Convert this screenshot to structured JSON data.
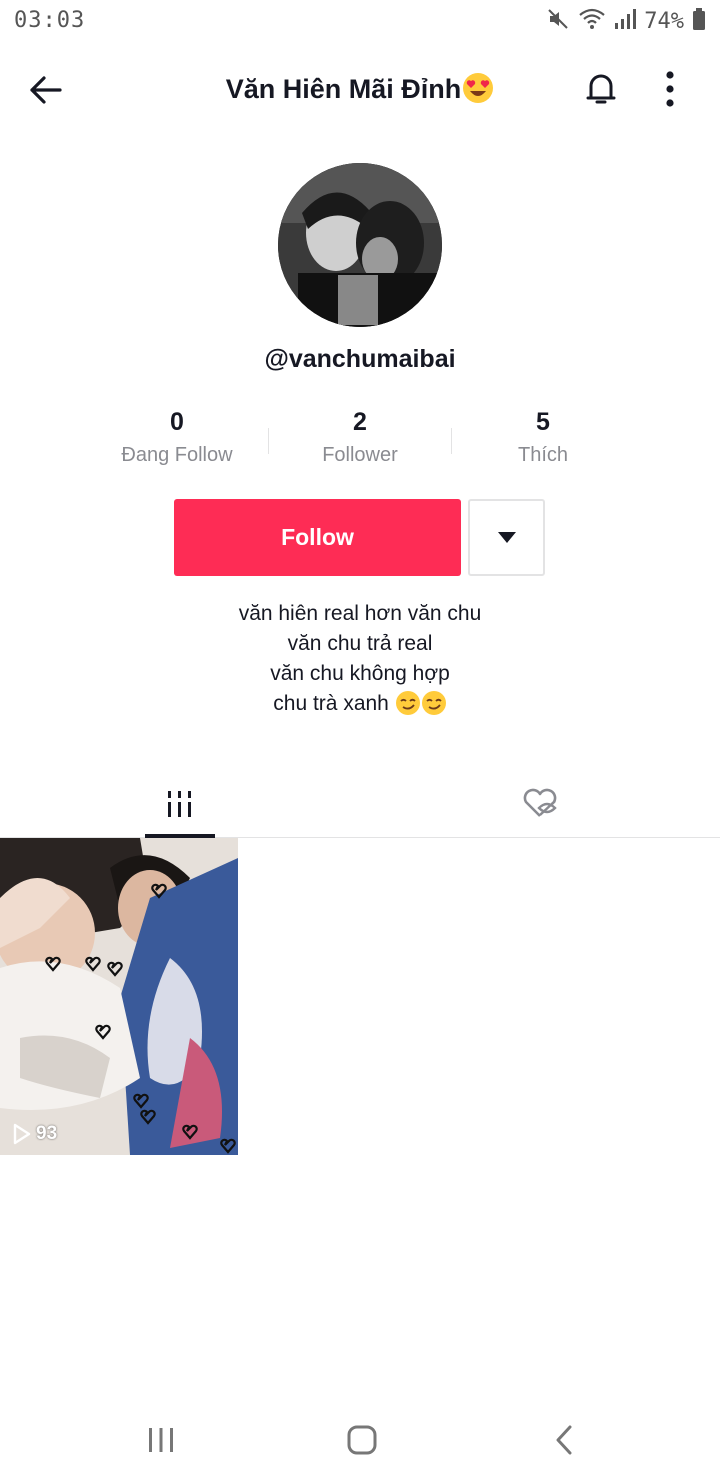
{
  "status_bar": {
    "time": "03:03",
    "battery": "74%",
    "icons": [
      "mute-icon",
      "wifi-icon",
      "signal-icon",
      "battery-icon"
    ]
  },
  "header": {
    "title": "Văn Hiên Mãi Đỉnh",
    "title_emoji": "heart-eyes-emoji",
    "icons": [
      "back-arrow-icon",
      "bell-icon",
      "more-vertical-icon"
    ]
  },
  "profile": {
    "username": "@vanchumaibai",
    "stats": [
      {
        "value": "0",
        "label": "Đang Follow"
      },
      {
        "value": "2",
        "label": "Follower"
      },
      {
        "value": "5",
        "label": "Thích"
      }
    ],
    "follow_label": "Follow",
    "bio_lines": [
      "văn hiên real hơn văn chu",
      "văn chu trả real",
      "văn chu không hợp",
      "chu trà xanh"
    ],
    "bio_emoji": "smirk-emoji"
  },
  "tabs": {
    "icons": [
      "videos-grid-icon",
      "liked-hidden-icon"
    ],
    "active": "videos"
  },
  "videos": [
    {
      "views": "93"
    }
  ],
  "nav": {
    "icons": [
      "recent-apps-icon",
      "home-icon",
      "back-icon"
    ]
  },
  "colors": {
    "accent": "#fe2c55",
    "text": "#161823",
    "muted": "#8a8b91",
    "divider": "#e3e3e4"
  }
}
